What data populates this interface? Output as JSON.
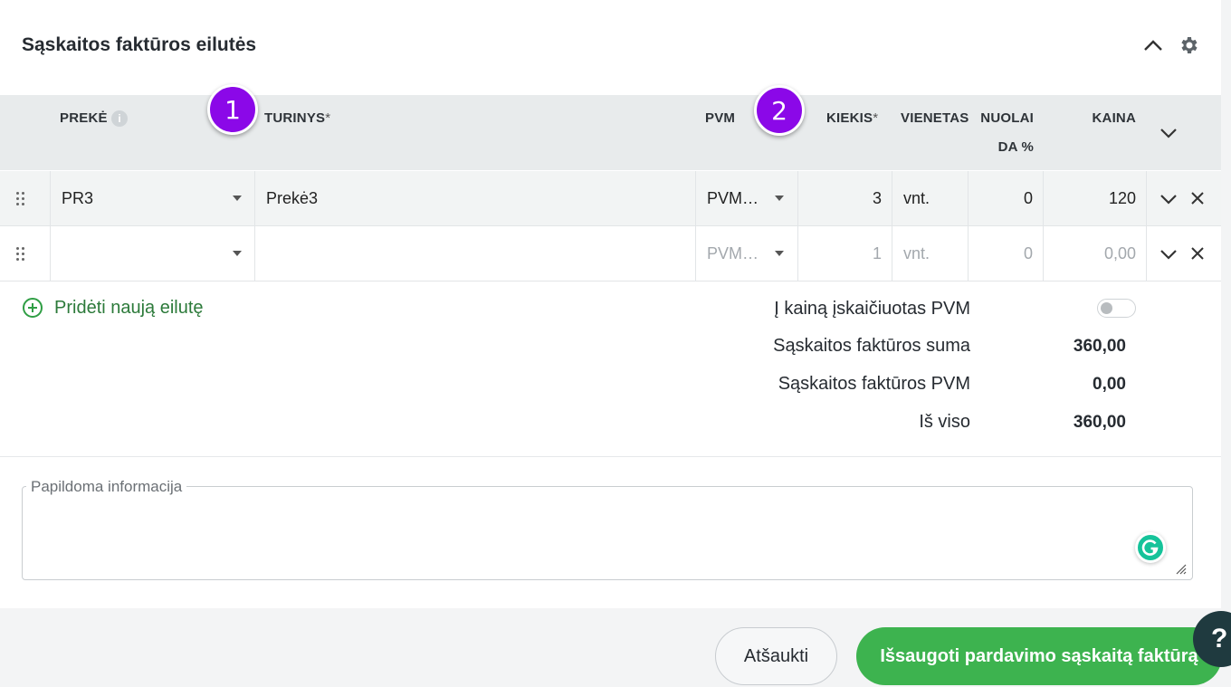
{
  "section": {
    "title": "Sąskaitos faktūros eilutės",
    "collapse_icon": "chevron-up-icon",
    "settings_icon": "gear-icon"
  },
  "columns": {
    "preke": "PREKĖ",
    "turinys": "TURINYS",
    "pvm": "PVM",
    "kiekis": "KIEKIS",
    "vienetas": "VIENETAS",
    "nuolaida_line1": "NUOLAI",
    "nuolaida_line2": "DA %",
    "kaina": "KAINA",
    "required_mark": "*"
  },
  "rows": [
    {
      "preke": "PR3",
      "turinys": "Prekė3",
      "pvm": "PVM…",
      "kiekis": "3",
      "vienetas": "vnt.",
      "nuolaida": "0",
      "kaina": "120"
    },
    {
      "preke": "",
      "turinys": "",
      "pvm": "PVM…",
      "kiekis": "1",
      "vienetas": "vnt.",
      "nuolaida": "0",
      "kaina": "0,00"
    }
  ],
  "badges": {
    "b1": "1",
    "b2": "2"
  },
  "add_row": "Pridėti naują eilutę",
  "summary": {
    "vat_included_label": "Į kainą įskaičiuotas PVM",
    "vat_included": false,
    "sum_label": "Sąskaitos faktūros suma",
    "sum_value": "360,00",
    "vat_label": "Sąskaitos faktūros PVM",
    "vat_value": "0,00",
    "total_label": "Iš viso",
    "total_value": "360,00"
  },
  "additional_info": {
    "label": "Papildoma informacija",
    "value": ""
  },
  "buttons": {
    "cancel": "Atšaukti",
    "save": "Išsaugoti pardavimo sąskaitą faktūrą"
  },
  "help": "?",
  "colors": {
    "accent_green": "#3db34f",
    "badge_purple": "#8b08e8",
    "header_bg": "#e8ebec"
  }
}
